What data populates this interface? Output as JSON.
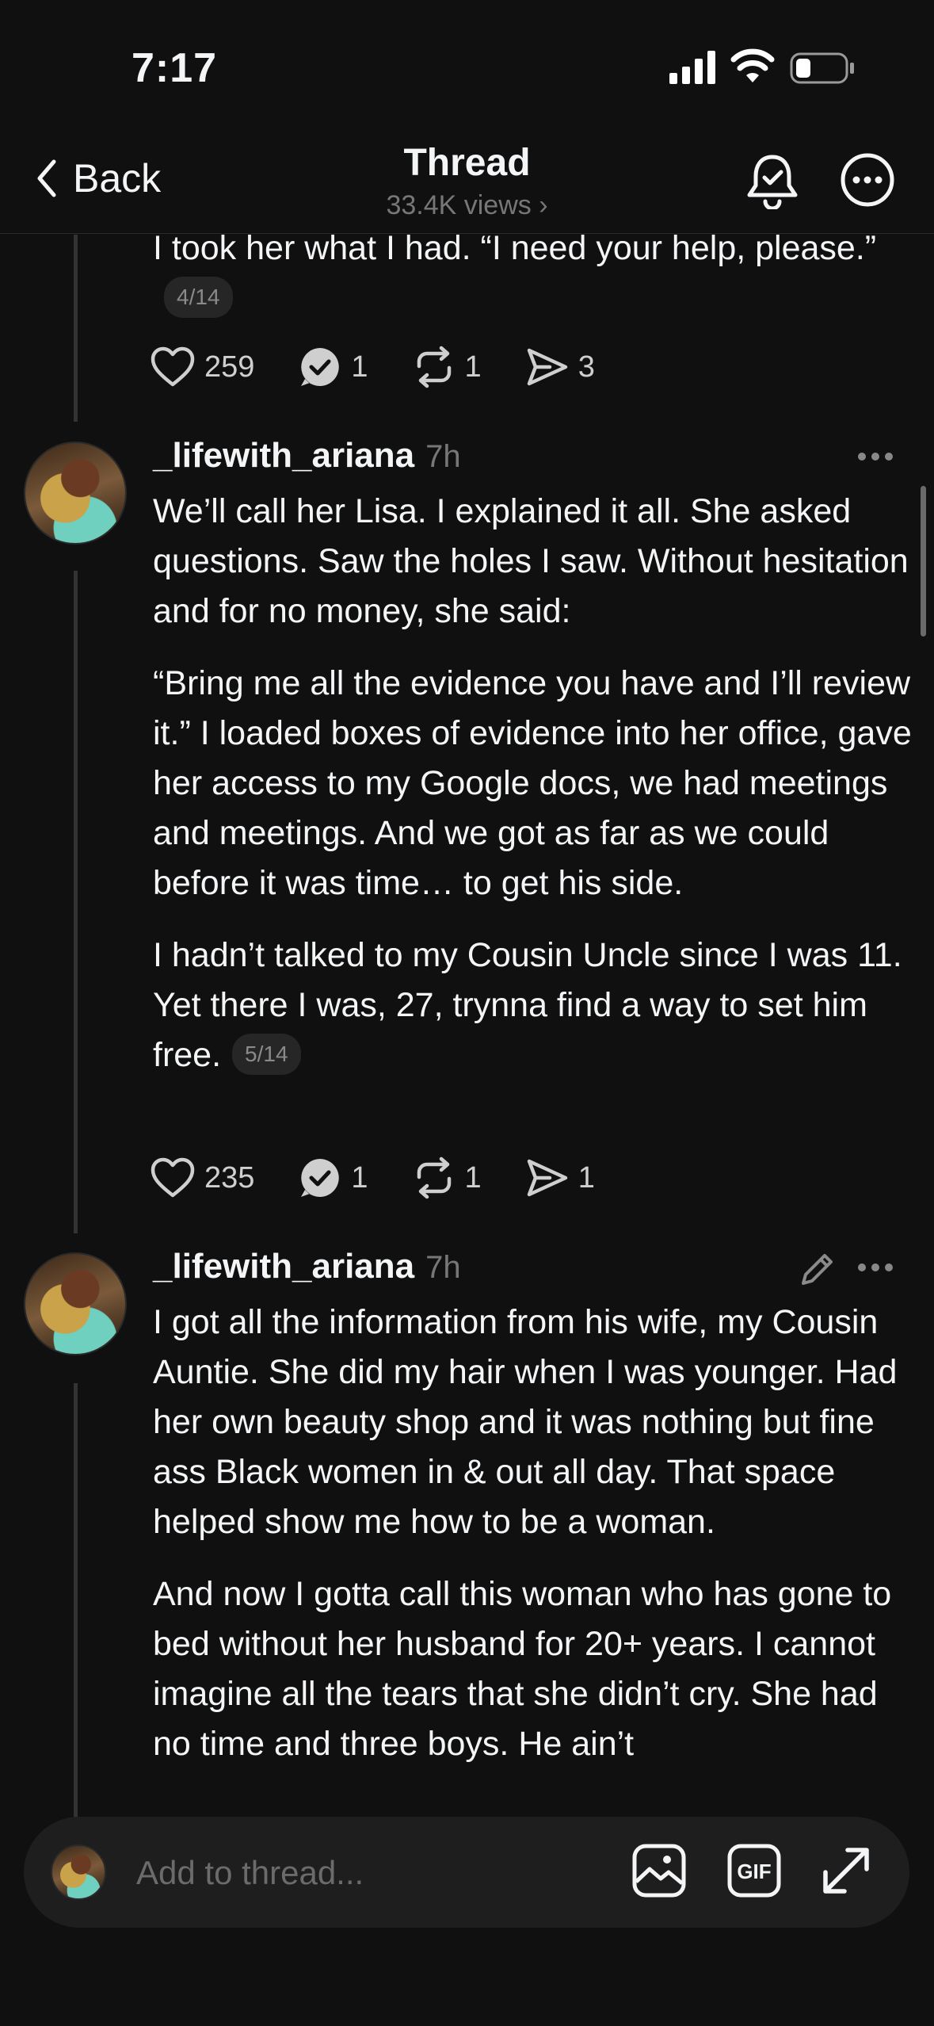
{
  "status_bar": {
    "time": "7:17"
  },
  "header": {
    "back_label": "Back",
    "title": "Thread",
    "views": "33.4K views ›"
  },
  "posts": [
    {
      "paragraphs": [
        "I took her what I had. “I need your help, please.”"
      ],
      "counter": "4/14",
      "likes": "259",
      "replies": "1",
      "reposts": "1",
      "shares": "3"
    },
    {
      "author": "_lifewith_ariana",
      "time_ago": "7h",
      "paragraphs": [
        "We’ll call her Lisa. I explained it all. She asked questions. Saw the holes I saw. Without hesitation and for no money, she said:",
        "“Bring me all the evidence you have and I’ll review it.” I loaded boxes of evidence into her office, gave her access to my Google docs, we had meetings and meetings. And we got as far as we could before it was time… to get his side.",
        "I hadn’t talked to my Cousin Uncle since I was 11. Yet there I was, 27, trynna find a way to set him free."
      ],
      "counter": "5/14",
      "likes": "235",
      "replies": "1",
      "reposts": "1",
      "shares": "1"
    },
    {
      "author": "_lifewith_ariana",
      "time_ago": "7h",
      "paragraphs": [
        "I got all the information from his wife, my Cousin Auntie. She did my hair when I was younger. Had her own beauty shop and it was nothing but fine ass Black women in & out all day. That space helped show me how to be a woman.",
        "And now I gotta call this woman who has gone to bed without her husband for 20+ years. I cannot imagine all the tears that she didn’t cry. She had no time and three boys. He ain’t"
      ]
    }
  ],
  "compose": {
    "placeholder": "Add to thread..."
  },
  "icons": {
    "back": "chevron-left-icon",
    "bell": "bell-icon",
    "more": "more-circle-icon",
    "like": "heart-icon",
    "reply": "reply-check-bubble-icon",
    "repost": "repost-icon",
    "share": "send-icon",
    "edit": "pencil-icon",
    "image": "image-icon",
    "gif": "gif-icon",
    "expand": "expand-icon"
  }
}
